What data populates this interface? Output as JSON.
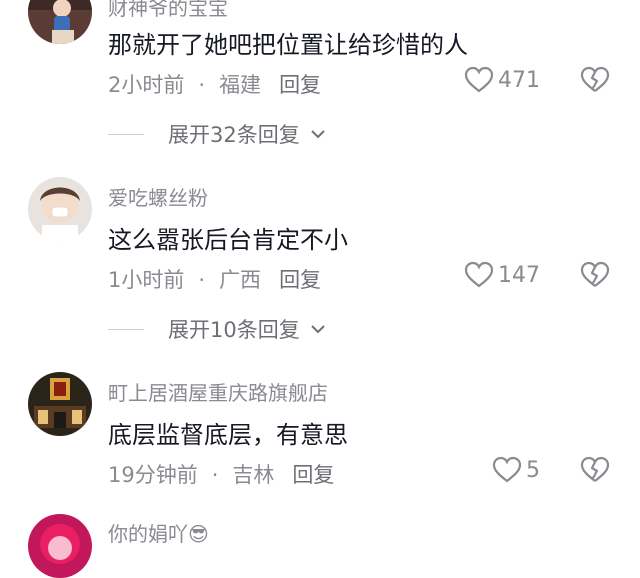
{
  "comments": [
    {
      "username": "财神爷的宝宝",
      "text": "那就开了她吧把位置让给珍惜的人",
      "time": "2小时前",
      "dot": "·",
      "location": "福建",
      "reply_label": "回复",
      "likes": "471",
      "expand_label": "展开32条回复"
    },
    {
      "username": "爱吃螺丝粉",
      "text": "这么嚣张后台肯定不小",
      "time": "1小时前",
      "dot": "·",
      "location": "广西",
      "reply_label": "回复",
      "likes": "147",
      "expand_label": "展开10条回复"
    },
    {
      "username": "町上居酒屋重庆路旗舰店",
      "text": "底层监督底层，有意思",
      "time": "19分钟前",
      "dot": "·",
      "location": "吉林",
      "reply_label": "回复",
      "likes": "5"
    },
    {
      "username": "你的娟吖😎"
    }
  ],
  "colors": {
    "secondary_text": "#8a8b91",
    "primary_text": "#161823",
    "icon_stroke": "#8a8b91"
  }
}
